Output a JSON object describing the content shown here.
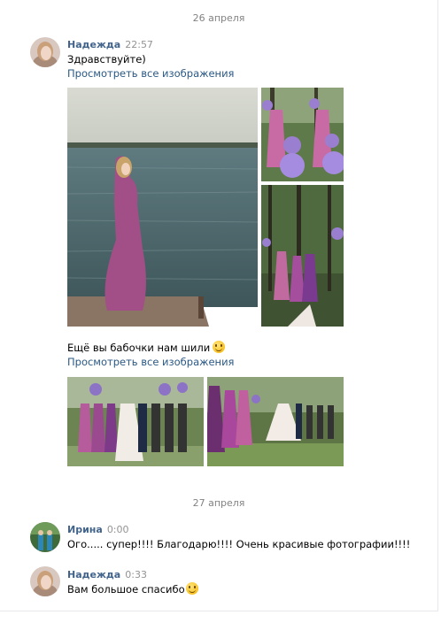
{
  "dates": {
    "first": "26 апреля",
    "second": "27 апреля"
  },
  "messages": [
    {
      "author": "Надежда",
      "time": "22:57",
      "text": "Здравствуйте)",
      "link": "Просмотреть все изображения"
    },
    {
      "text": "Ещё вы бабочки нам шили",
      "link": "Просмотреть все изображения"
    },
    {
      "author": "Ирина",
      "time": "0:00",
      "text": "Ого..... супер!!!! Благодарю!!!! Очень красивые фотографии!!!!"
    },
    {
      "author": "Надежда",
      "time": "0:33",
      "text": "Вам большое спасибо"
    }
  ],
  "colors": {
    "author": "#42648b",
    "link": "#2a5885",
    "time": "#939393",
    "date": "#828282"
  },
  "icons": {
    "smile": "smile-emoji-icon"
  }
}
